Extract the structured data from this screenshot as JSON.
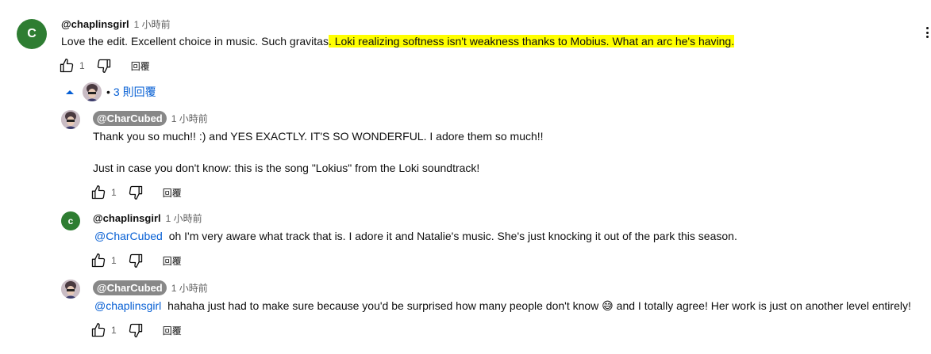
{
  "comment": {
    "avatar_letter": "C",
    "author": "@chaplinsgirl",
    "time": "1 小時前",
    "text_plain": "Love the edit. Excellent choice in music. Such gravitas",
    "text_highlight": ". Loki realizing softness isn't weakness thanks to Mobius. What an arc he's having.",
    "likes": "1",
    "reply_label": "回覆"
  },
  "replies_toggle": {
    "label": "3 則回覆"
  },
  "replies": [
    {
      "author": "@CharCubed",
      "time": "1 小時前",
      "line1": "Thank you so much!! :)  and YES EXACTLY. IT'S SO WONDERFUL. I adore them so much!!",
      "line2": "Just in case you don't know: this is the song \"Lokius\" from the Loki soundtrack!",
      "likes": "1",
      "reply_label": "回覆"
    },
    {
      "avatar_letter": "c",
      "author": "@chaplinsgirl",
      "time": "1 小時前",
      "mention": "@CharCubed",
      "text": "oh I'm very aware what track that is. I adore it and Natalie's music. She's just knocking it out of the park this season.",
      "likes": "1",
      "reply_label": "回覆"
    },
    {
      "author": "@CharCubed",
      "time": "1 小時前",
      "mention": "@chaplinsgirl",
      "text_before_emoji": "hahaha just had to make sure because you'd be surprised how many people don't know",
      "emoji": "😅",
      "text_after_emoji": "and I totally agree! Her work is just on another level entirely!",
      "likes": "1",
      "reply_label": "回覆"
    }
  ],
  "colors": {
    "highlight": "#ffff00",
    "link": "#065fd4",
    "avatar_green": "#2e7d32",
    "chip": "#888888"
  }
}
